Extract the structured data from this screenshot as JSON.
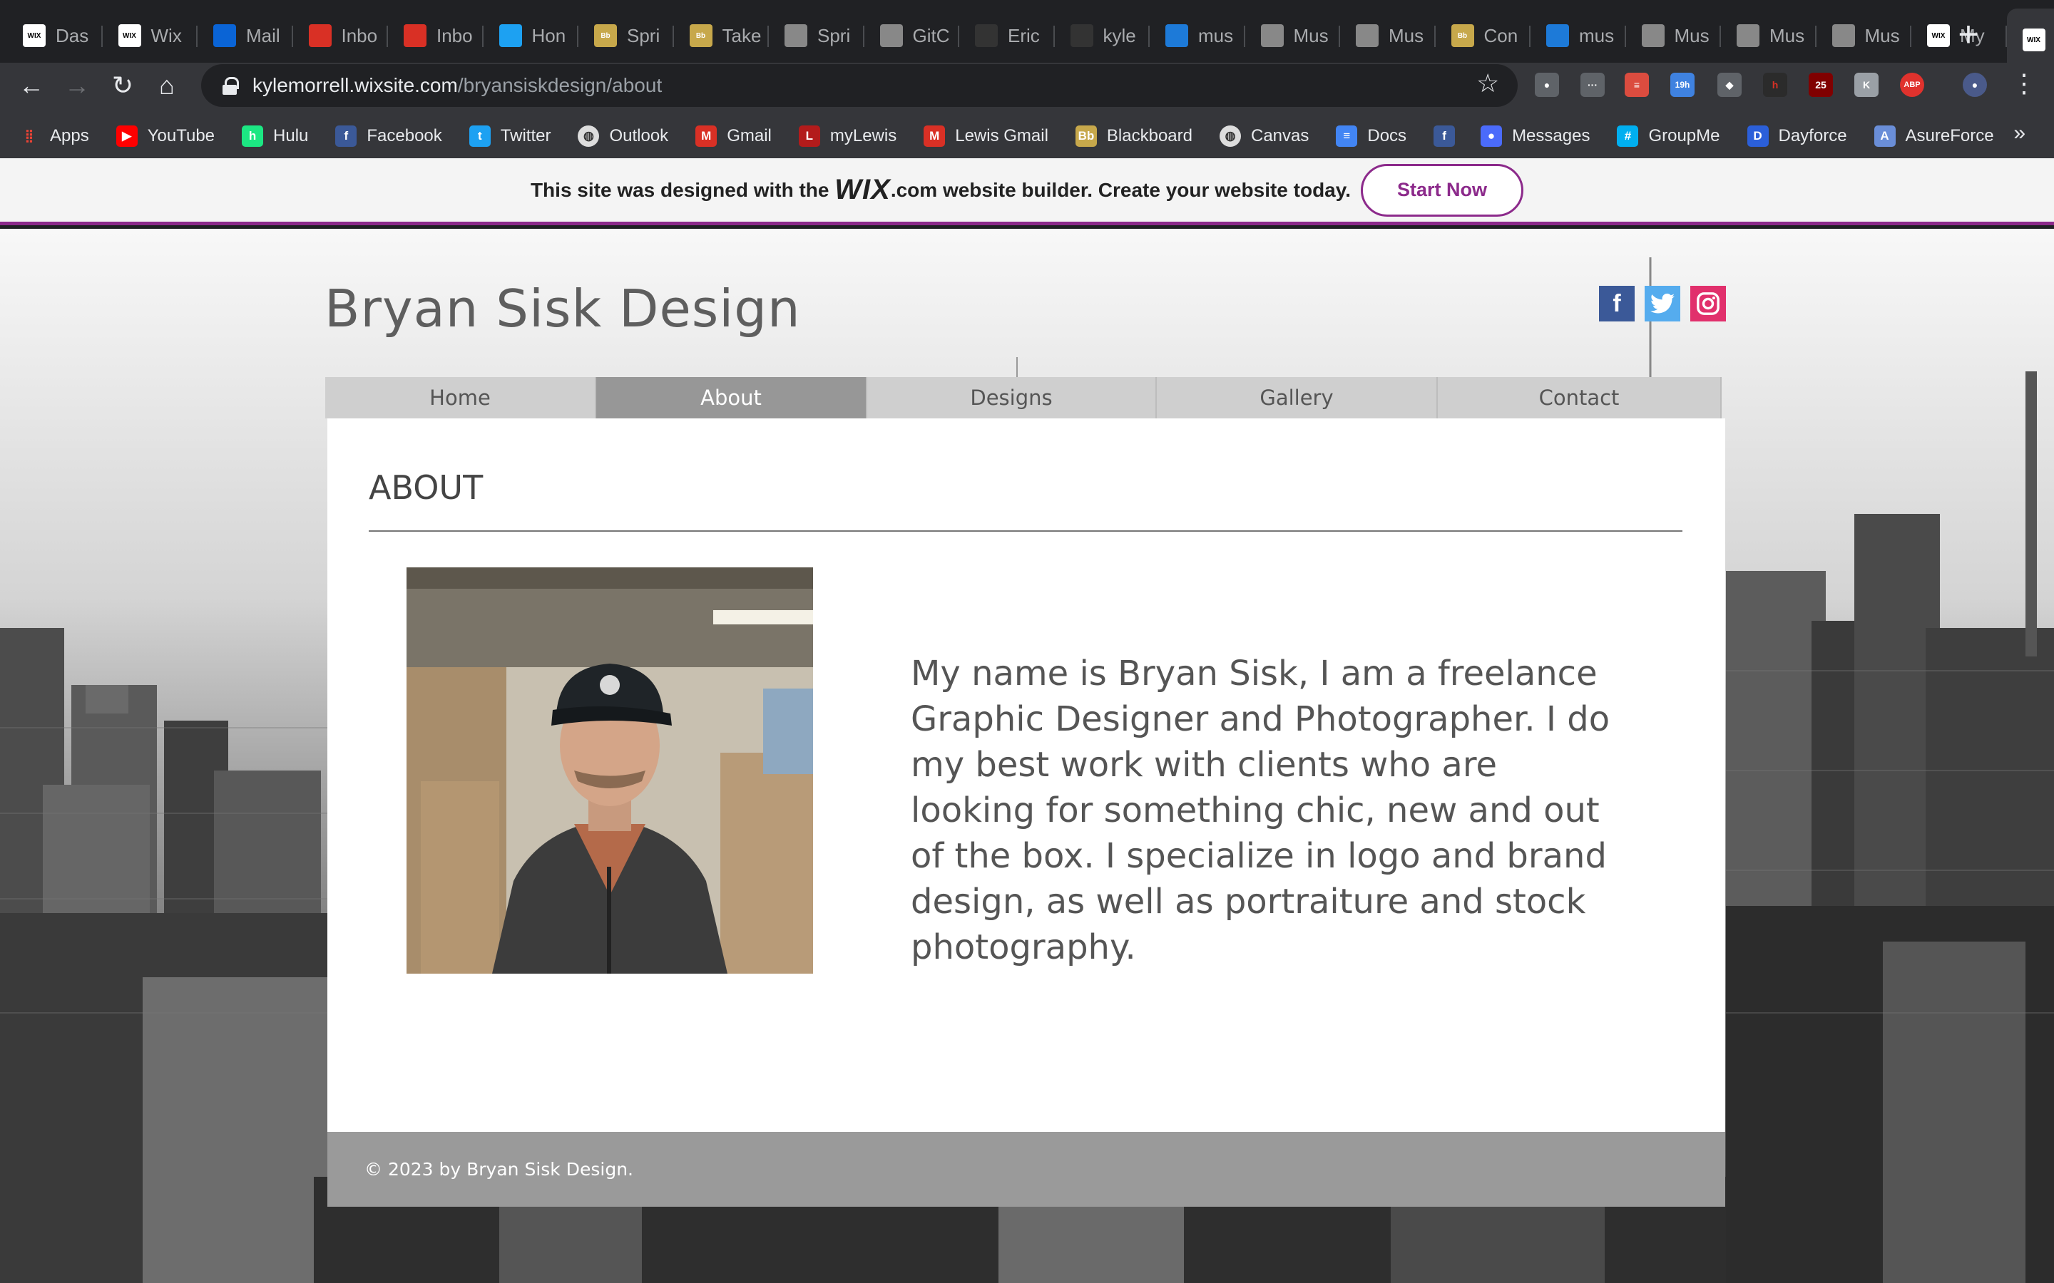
{
  "browser": {
    "tabs": [
      {
        "title": "Das",
        "icon": "wix-icon",
        "color": "#ffffff"
      },
      {
        "title": "Wix",
        "icon": "wix-icon",
        "color": "#ffffff"
      },
      {
        "title": "Mail",
        "icon": "outlook-icon",
        "color": "#0a64d6"
      },
      {
        "title": "Inbo",
        "icon": "gmail-icon",
        "color": "#d93025"
      },
      {
        "title": "Inbo",
        "icon": "gmail-icon",
        "color": "#d93025"
      },
      {
        "title": "Hon",
        "icon": "twitter-icon",
        "color": "#1da1f2"
      },
      {
        "title": "Spri",
        "icon": "blackboard-icon",
        "color": "#c7a84b"
      },
      {
        "title": "Take",
        "icon": "blackboard-icon",
        "color": "#c7a84b"
      },
      {
        "title": "Spri",
        "icon": "globe-icon",
        "color": "#888888"
      },
      {
        "title": "GitC",
        "icon": "globe-icon",
        "color": "#888888"
      },
      {
        "title": "Eric",
        "icon": "github-icon",
        "color": "#333333"
      },
      {
        "title": "kyle",
        "icon": "github-icon",
        "color": "#333333"
      },
      {
        "title": "mus",
        "icon": "azure-icon",
        "color": "#1d7ad8"
      },
      {
        "title": "Mus",
        "icon": "globe-icon",
        "color": "#888888"
      },
      {
        "title": "Mus",
        "icon": "globe-icon",
        "color": "#888888"
      },
      {
        "title": "Con",
        "icon": "blackboard-icon",
        "color": "#c7a84b"
      },
      {
        "title": "mus",
        "icon": "azure-icon",
        "color": "#1d7ad8"
      },
      {
        "title": "Mus",
        "icon": "globe-icon",
        "color": "#888888"
      },
      {
        "title": "Mus",
        "icon": "globe-icon",
        "color": "#888888"
      },
      {
        "title": "Mus",
        "icon": "globe-icon",
        "color": "#888888"
      },
      {
        "title": "My",
        "icon": "wix-icon",
        "color": "#ffffff"
      },
      {
        "title": "",
        "icon": "wix-icon",
        "color": "#ffffff",
        "active": true
      }
    ],
    "url_host": "kylemorrell.wixsite.com",
    "url_path": "/bryansiskdesign/about",
    "extension_badges": {
      "timer": "19h",
      "ublock": "25",
      "abp": "ABP"
    },
    "bookmarks": [
      {
        "label": "Apps",
        "icon": "apps-grid-icon",
        "color": "#ea4335"
      },
      {
        "label": "YouTube",
        "icon": "youtube-icon",
        "color": "#ff0000"
      },
      {
        "label": "Hulu",
        "icon": "hulu-icon",
        "color": "#1ce783"
      },
      {
        "label": "Facebook",
        "icon": "facebook-icon",
        "color": "#3b5998"
      },
      {
        "label": "Twitter",
        "icon": "twitter-icon",
        "color": "#1da1f2"
      },
      {
        "label": "Outlook",
        "icon": "globe-icon",
        "color": "#dddddd"
      },
      {
        "label": "Gmail",
        "icon": "gmail-icon",
        "color": "#d93025"
      },
      {
        "label": "myLewis",
        "icon": "lewis-icon",
        "color": "#b31b1b"
      },
      {
        "label": "Lewis Gmail",
        "icon": "gmail-icon",
        "color": "#d93025"
      },
      {
        "label": "Blackboard",
        "icon": "blackboard-icon",
        "color": "#c7a84b"
      },
      {
        "label": "Canvas",
        "icon": "globe-icon",
        "color": "#dddddd"
      },
      {
        "label": "Docs",
        "icon": "docs-icon",
        "color": "#4285f4"
      },
      {
        "label": "",
        "icon": "facebook-icon",
        "color": "#3b5998"
      },
      {
        "label": "Messages",
        "icon": "messages-icon",
        "color": "#4b6bfb"
      },
      {
        "label": "GroupMe",
        "icon": "groupme-icon",
        "color": "#00aff0"
      },
      {
        "label": "Dayforce",
        "icon": "dayforce-icon",
        "color": "#2b5fd9"
      },
      {
        "label": "AsureForce",
        "icon": "asureforce-icon",
        "color": "#6a8ed8"
      }
    ]
  },
  "wix_banner": {
    "prefix": "This site was designed with the",
    "logo": "WIX",
    "suffix": ".com website builder. Create your website today.",
    "cta": "Start Now",
    "accent": "#8c2a8b"
  },
  "site": {
    "title": "Bryan Sisk Design",
    "social": [
      {
        "name": "facebook",
        "glyph": "f",
        "color": "#3b5998"
      },
      {
        "name": "twitter",
        "glyph": "t",
        "color": "#55acee"
      },
      {
        "name": "instagram",
        "glyph": "◎",
        "color": "#e1306c"
      }
    ],
    "nav": [
      {
        "label": "Home",
        "active": false
      },
      {
        "label": "About",
        "active": true
      },
      {
        "label": "Designs",
        "active": false
      },
      {
        "label": "Gallery",
        "active": false
      },
      {
        "label": "Contact",
        "active": false
      }
    ],
    "about": {
      "heading": "ABOUT",
      "bio": "My name is Bryan Sisk, I am a freelance Graphic Designer and Photographer. I do my best work with clients who are looking for something chic, new and out of the box. I specialize in logo and brand design, as well as portraiture and stock photography."
    },
    "footer": "© 2023 by Bryan Sisk Design."
  }
}
